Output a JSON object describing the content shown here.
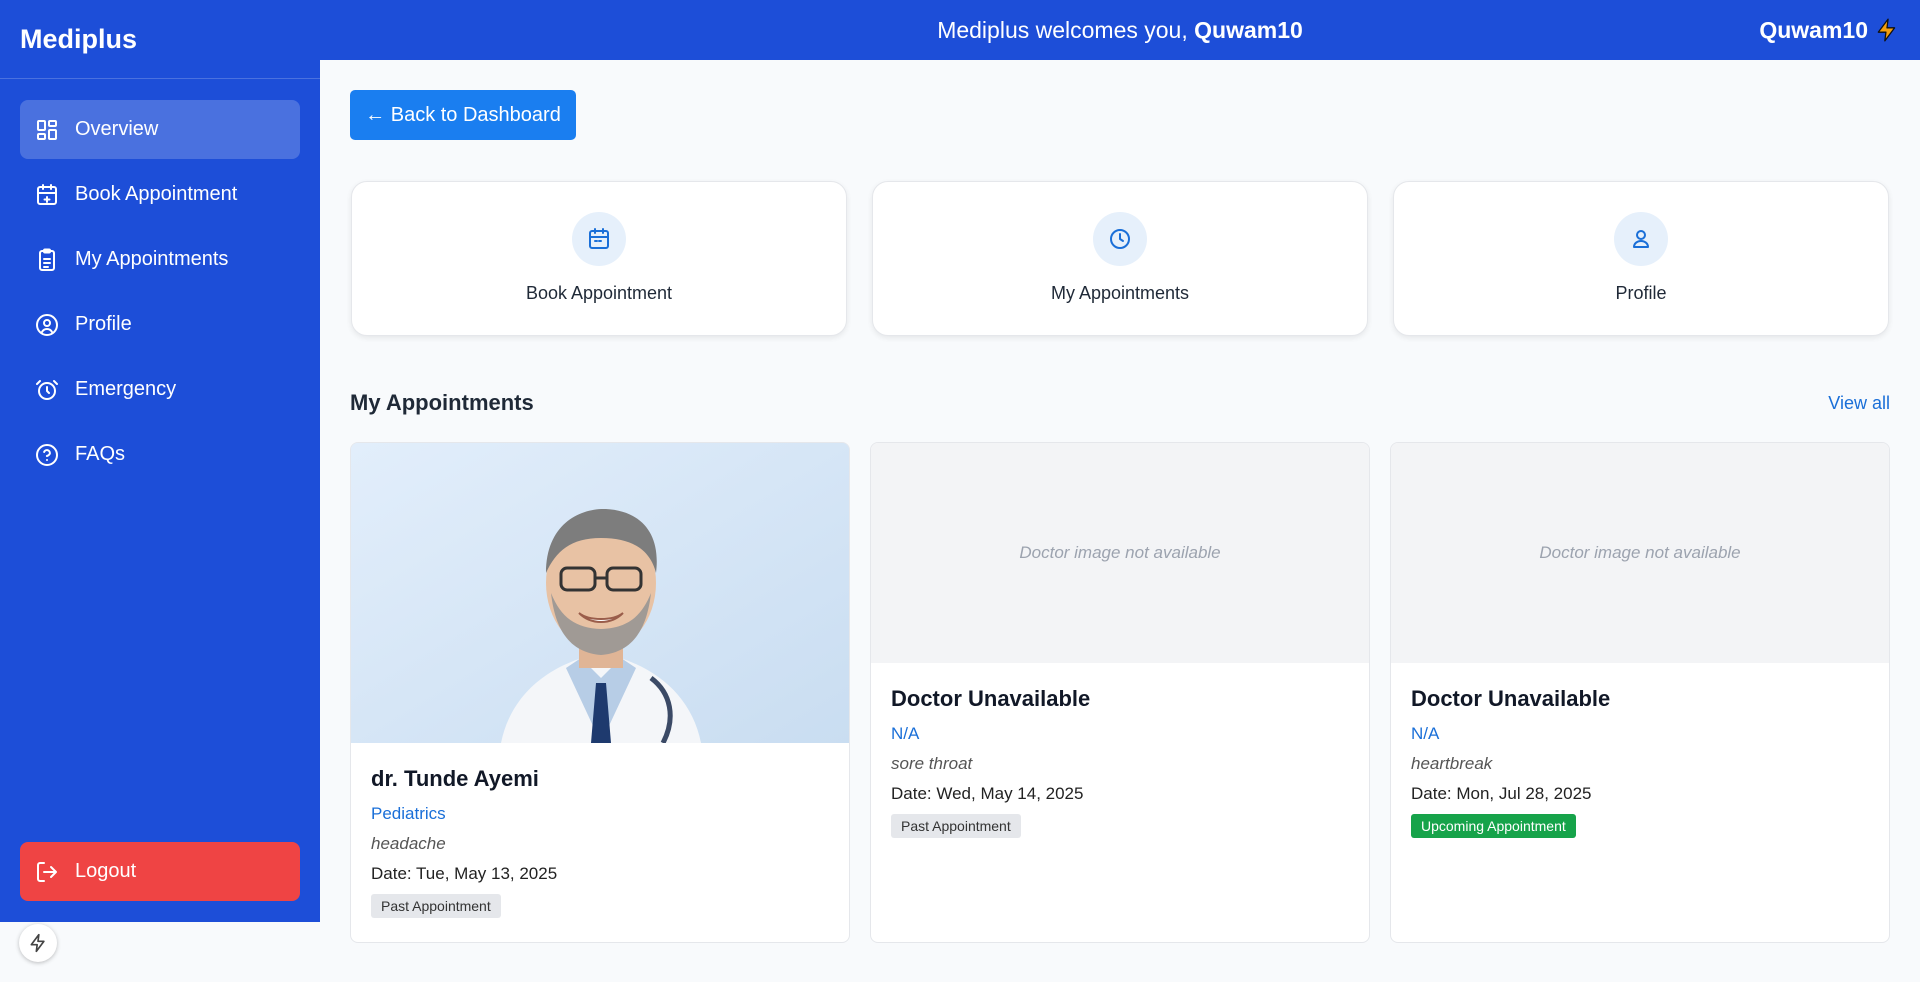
{
  "app": {
    "brand": "Mediplus",
    "welcome_prefix": "Mediplus welcomes you, ",
    "welcome_user": "Quwam10",
    "user_name": "Quwam10"
  },
  "sidebar": {
    "items": [
      {
        "label": "Overview",
        "icon": "layout-grid-icon"
      },
      {
        "label": "Book Appointment",
        "icon": "calendar-plus-icon"
      },
      {
        "label": "My Appointments",
        "icon": "clipboard-list-icon"
      },
      {
        "label": "Profile",
        "icon": "user-circle-icon"
      },
      {
        "label": "Emergency",
        "icon": "alarm-clock-icon"
      },
      {
        "label": "FAQs",
        "icon": "help-circle-icon"
      }
    ],
    "logout_label": "Logout"
  },
  "main": {
    "back_label": "← Back to Dashboard",
    "quick_actions": [
      {
        "label": "Book Appointment",
        "icon": "calendar-icon"
      },
      {
        "label": "My Appointments",
        "icon": "clock-icon"
      },
      {
        "label": "Profile",
        "icon": "user-icon"
      }
    ],
    "section_title": "My Appointments",
    "view_all": "View all",
    "appointments": [
      {
        "doctor": "dr. Tunde Ayemi",
        "specialty": "Pediatrics",
        "reason": "headache",
        "date": "Date: Tue, May 13, 2025",
        "status": "Past Appointment",
        "image_text": ""
      },
      {
        "doctor": "Doctor Unavailable",
        "specialty": "N/A",
        "reason": "sore throat",
        "date": "Date: Wed, May 14, 2025",
        "status": "Past Appointment",
        "image_text": "Doctor image not available"
      },
      {
        "doctor": "Doctor Unavailable",
        "specialty": "N/A",
        "reason": "heartbreak",
        "date": "Date: Mon, Jul 28, 2025",
        "status": "Upcoming Appointment",
        "image_text": "Doctor image not available"
      }
    ]
  },
  "colors": {
    "primary": "#1d4ed8",
    "accent": "#1a7ef0",
    "danger": "#ef4444",
    "success": "#16a34a",
    "bolt": "#f59e0b"
  }
}
